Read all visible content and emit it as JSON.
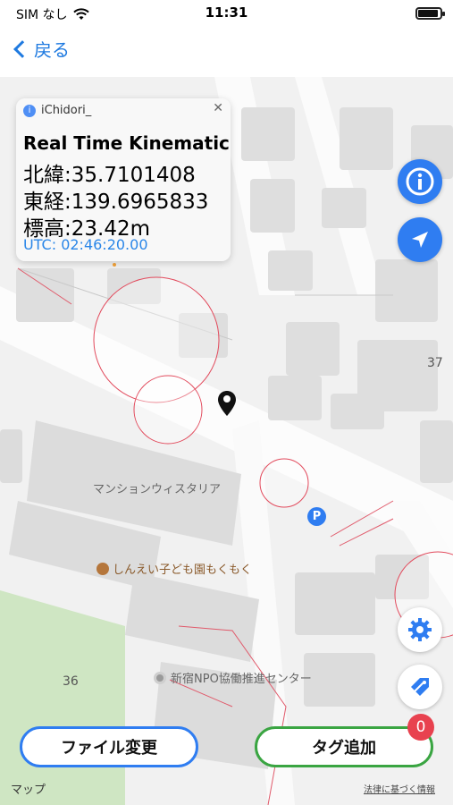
{
  "status": {
    "carrier": "SIM なし",
    "time": "11:31"
  },
  "nav": {
    "back_label": "戻る"
  },
  "callout": {
    "device_name": "iChidori_",
    "title": "Real Time Kinematic",
    "latitude": "北緯:35.7101408",
    "longitude": "東経:139.6965833",
    "altitude": "標高:23.42m",
    "utc": "UTC: 02:46:20.00"
  },
  "map_labels": {
    "building": "マンションウィスタリア",
    "nursery": "しんえい子ども園もくもく",
    "npo": "新宿NPO協働推進センター",
    "num37": "37",
    "num36": "36",
    "parking": "P"
  },
  "buttons": {
    "file_change": "ファイル変更",
    "add_tag": "タグ追加",
    "tag_count": "0"
  },
  "footer": {
    "apple_maps": "マップ",
    "legal": "法律に基づく情報"
  },
  "icons": [
    "info-icon",
    "locate-arrow-icon",
    "gear-icon",
    "tag-edit-icon",
    "pin-icon",
    "parking-icon"
  ],
  "colors": {
    "accent_blue": "#2f7df1",
    "accent_green": "#3aa542",
    "badge_red": "#e8424f",
    "link_blue": "#2a86e8"
  }
}
